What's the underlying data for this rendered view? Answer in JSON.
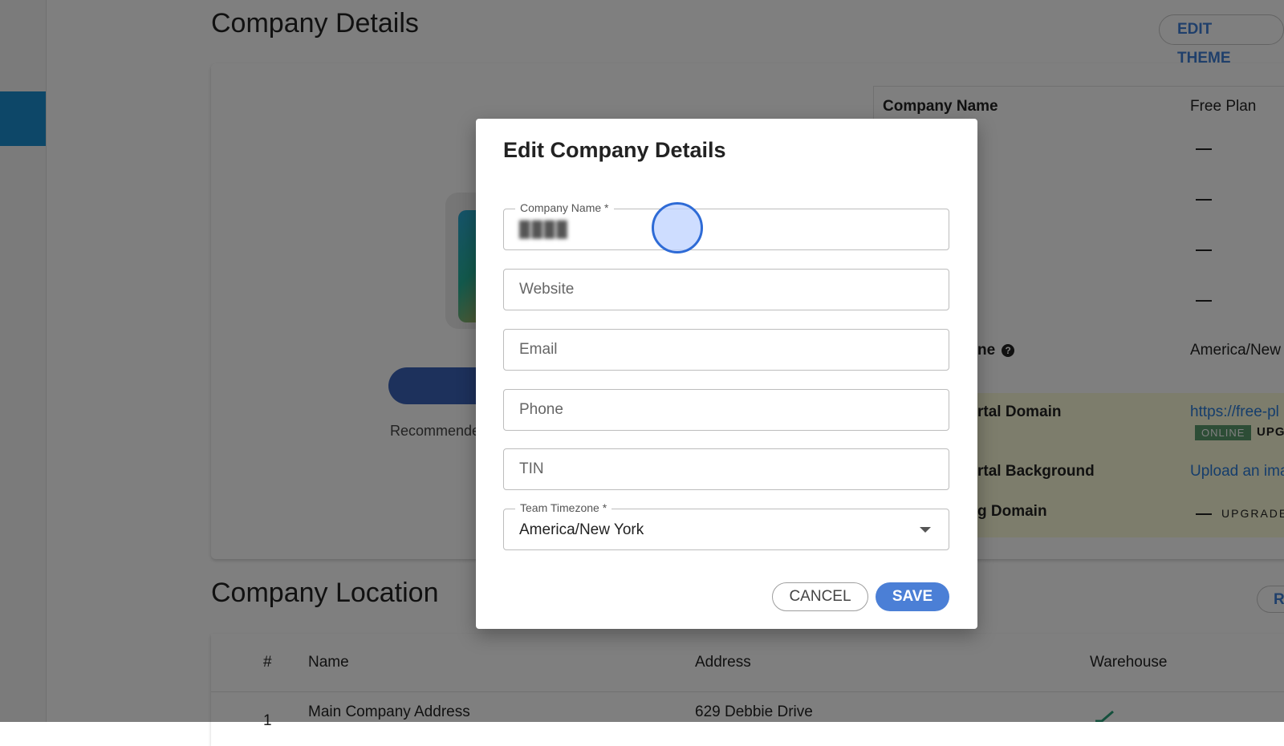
{
  "page": {
    "title": "Company Details",
    "edit_theme_label": "EDIT THEME",
    "recommended_text": "Recommende"
  },
  "info": {
    "company_name_label": "Company Name",
    "company_name_value": "Free Plan",
    "timezone_label_partial": "ne",
    "timezone_value": "America/New",
    "portal_domain_label_partial": "rtal Domain",
    "portal_domain_value": "https://free-pl",
    "online_badge": "ONLINE",
    "upg_text": "UPG",
    "portal_background_label_partial": "rtal Background",
    "portal_background_value": "Upload an ima",
    "billing_domain_label_partial": "g Domain",
    "upgrade_label": "UPGRADE"
  },
  "location": {
    "title": "Company Location",
    "button_partial": "R",
    "columns": [
      "#",
      "Name",
      "Address",
      "Warehouse"
    ],
    "rows": [
      {
        "index": "1",
        "name": "Main Company Address",
        "address": "629 Debbie Drive"
      }
    ]
  },
  "dialog": {
    "title": "Edit Company Details",
    "company_name_label": "Company Name *",
    "company_name_value": "████",
    "website_placeholder": "Website",
    "email_placeholder": "Email",
    "phone_placeholder": "Phone",
    "tin_placeholder": "TIN",
    "timezone_label": "Team Timezone *",
    "timezone_value": "America/New York",
    "cancel_label": "CANCEL",
    "save_label": "SAVE"
  },
  "icons": {
    "help": "help-circle-icon",
    "dropdown": "chevron-down-icon",
    "check": "check-icon"
  }
}
